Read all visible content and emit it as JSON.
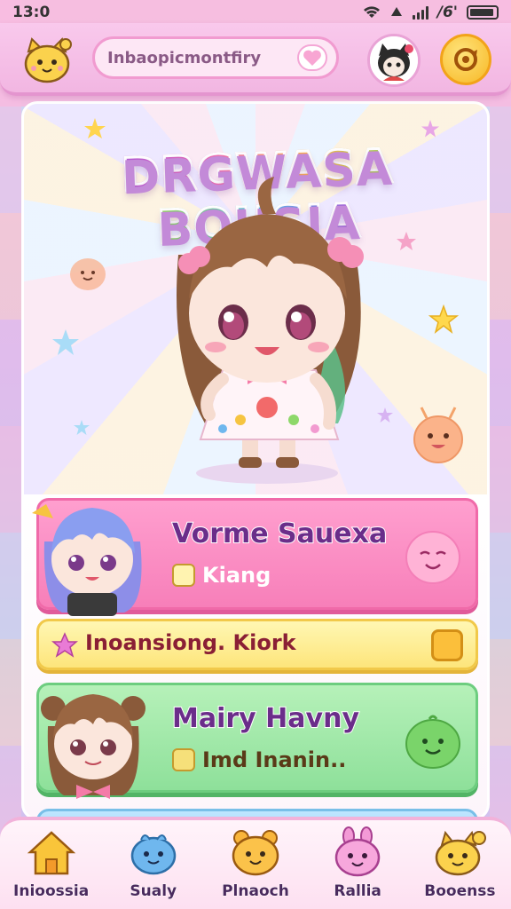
{
  "status_bar": {
    "time": "13:0",
    "network": "/6'"
  },
  "header": {
    "search_text": "Inbaopicmontfiry",
    "mascot_icon": "cat-mascot-icon",
    "search_icon": "heart-icon",
    "avatar_icon": "cat-avatar",
    "refresh_icon": "refresh-icon"
  },
  "banner": {
    "title": "DRGWASA BOUSIA"
  },
  "list": [
    {
      "title": "Vorme Sauexa",
      "subtitle": "Kiang",
      "color": "#f77fb9",
      "character": "blue-haired-girl",
      "blob": "pink-blob-icon"
    },
    {
      "label": "Inoansiong. Kiork",
      "color": "#fde57b",
      "icon": "star-icon"
    },
    {
      "title": "Mairy Havny",
      "subtitle": "Imd Inanin..",
      "color": "#8ee09a",
      "character": "brown-haired-girl",
      "blob": "green-blob-icon"
    }
  ],
  "nav": [
    {
      "label": "Inioossia",
      "icon": "home-icon"
    },
    {
      "label": "Sualy",
      "icon": "blue-creature-icon"
    },
    {
      "label": "Plnaoch",
      "icon": "orange-creature-icon"
    },
    {
      "label": "Rallia",
      "icon": "pink-bunny-icon"
    },
    {
      "label": "Booenss",
      "icon": "yellow-mascot-icon"
    }
  ],
  "colors": {
    "accent_pink": "#f77fb9",
    "accent_yellow": "#fde57b",
    "accent_green": "#8ee09a",
    "title_purple": "#6b2d8a"
  }
}
